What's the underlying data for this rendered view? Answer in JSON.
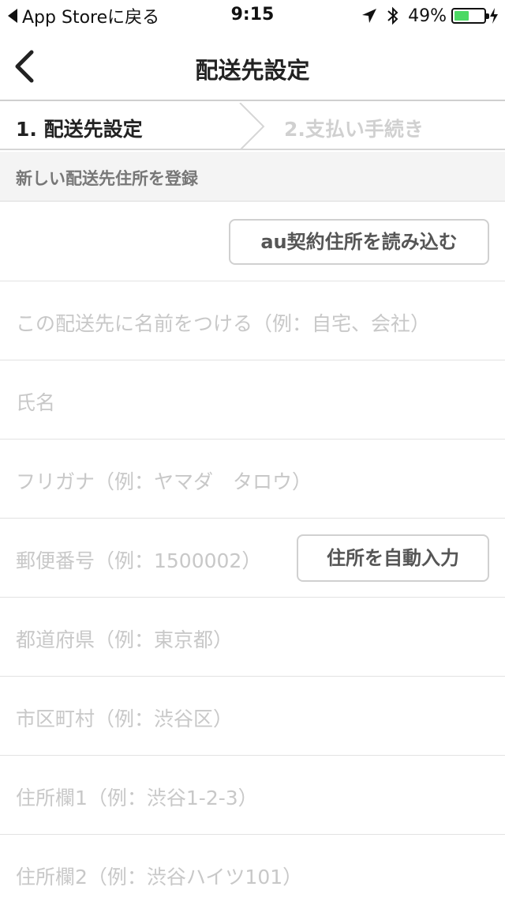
{
  "status_bar": {
    "back_app": "App Storeに戻る",
    "time": "9:15",
    "battery_percent": "49%",
    "battery_level": 0.49,
    "battery_color": "#4cd964"
  },
  "nav": {
    "title": "配送先設定",
    "back_icon": "chevron-left-icon"
  },
  "steps": {
    "step1": "1. 配送先設定",
    "step2": "2.支払い手続き"
  },
  "section": {
    "title": "新しい配送先住所を登録"
  },
  "form": {
    "load_button": "au契約住所を読み込む",
    "name_label_placeholder": "この配送先に名前をつける（例：自宅、会社）",
    "full_name_placeholder": "氏名",
    "furigana_placeholder": "フリガナ（例：ヤマダ　タロウ）",
    "postal_placeholder": "郵便番号（例：1500002）",
    "auto_fill_button": "住所を自動入力",
    "prefecture_placeholder": "都道府県（例：東京都）",
    "city_placeholder": "市区町村（例：渋谷区）",
    "address1_placeholder": "住所欄1（例：渋谷1-2-3）",
    "address2_placeholder": "住所欄2（例：渋谷ハイツ101）"
  }
}
